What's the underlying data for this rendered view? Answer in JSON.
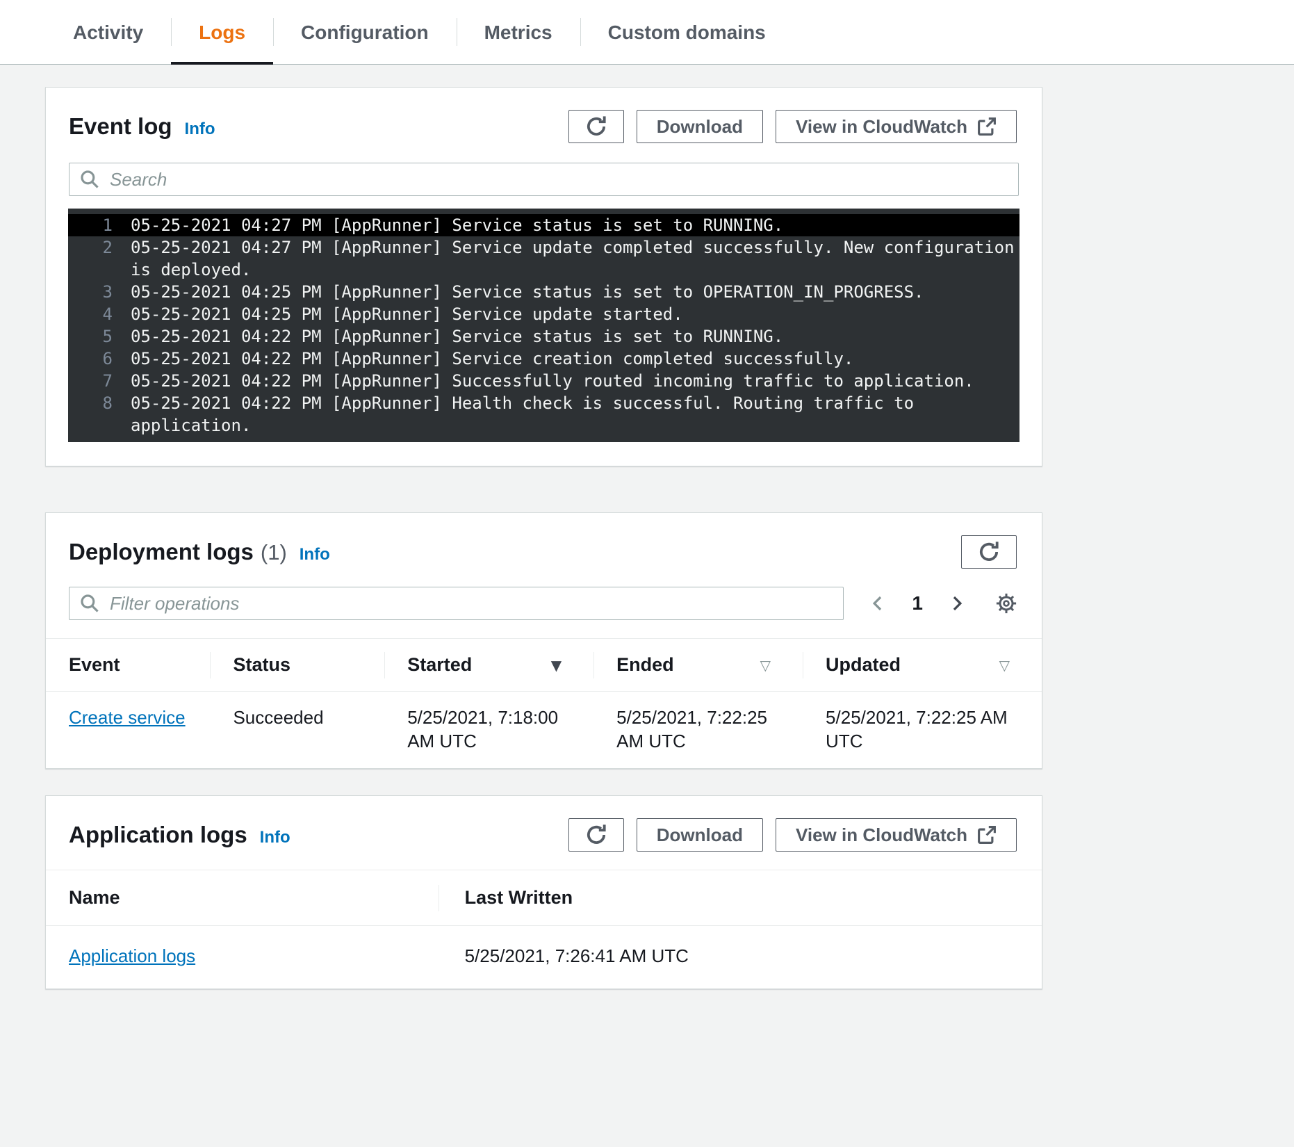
{
  "colors": {
    "page_background": "#f2f3f3",
    "accent_orange": "#ec7211",
    "link_blue": "#0073bb",
    "terminal_background": "#2d3134",
    "terminal_highlight": "#000000"
  },
  "icons": {
    "refresh": "circular-arrow",
    "search": "magnifier",
    "external_link": "box-with-arrow",
    "settings": "gear",
    "sort_desc_active": "▼",
    "sort_inactive": "▽"
  },
  "tabs": {
    "active": "Logs",
    "items": [
      {
        "label": "Activity"
      },
      {
        "label": "Logs"
      },
      {
        "label": "Configuration"
      },
      {
        "label": "Metrics"
      },
      {
        "label": "Custom domains"
      }
    ]
  },
  "event_log": {
    "title": "Event log",
    "info": "Info",
    "download": "Download",
    "view_in_cloudwatch": "View in CloudWatch",
    "search_placeholder": "Search",
    "lines": [
      {
        "num": "1",
        "text": "05-25-2021 04:27 PM [AppRunner] Service status is set to RUNNING."
      },
      {
        "num": "2",
        "text": "05-25-2021 04:27 PM [AppRunner] Service update completed successfully. New configuration is deployed."
      },
      {
        "num": "3",
        "text": "05-25-2021 04:25 PM [AppRunner] Service status is set to OPERATION_IN_PROGRESS."
      },
      {
        "num": "4",
        "text": "05-25-2021 04:25 PM [AppRunner] Service update started."
      },
      {
        "num": "5",
        "text": "05-25-2021 04:22 PM [AppRunner] Service status is set to RUNNING."
      },
      {
        "num": "6",
        "text": "05-25-2021 04:22 PM [AppRunner] Service creation completed successfully."
      },
      {
        "num": "7",
        "text": "05-25-2021 04:22 PM [AppRunner] Successfully routed incoming traffic to application."
      },
      {
        "num": "8",
        "text": "05-25-2021 04:22 PM [AppRunner] Health check is successful. Routing traffic to application."
      }
    ]
  },
  "deployment_logs": {
    "title": "Deployment logs",
    "count": "(1)",
    "info": "Info",
    "filter_placeholder": "Filter operations",
    "page_number": "1",
    "columns": {
      "event": "Event",
      "status": "Status",
      "started": "Started",
      "ended": "Ended",
      "updated": "Updated"
    },
    "row": {
      "event": "Create service",
      "status": "Succeeded",
      "started": "5/25/2021, 7:18:00 AM UTC",
      "ended": "5/25/2021, 7:22:25 AM UTC",
      "updated": "5/25/2021, 7:22:25 AM UTC"
    }
  },
  "application_logs": {
    "title": "Application logs",
    "info": "Info",
    "download": "Download",
    "view_in_cloudwatch": "View in CloudWatch",
    "columns": {
      "name": "Name",
      "last_written": "Last Written"
    },
    "row": {
      "name": "Application logs",
      "last_written": "5/25/2021, 7:26:41 AM UTC"
    }
  }
}
